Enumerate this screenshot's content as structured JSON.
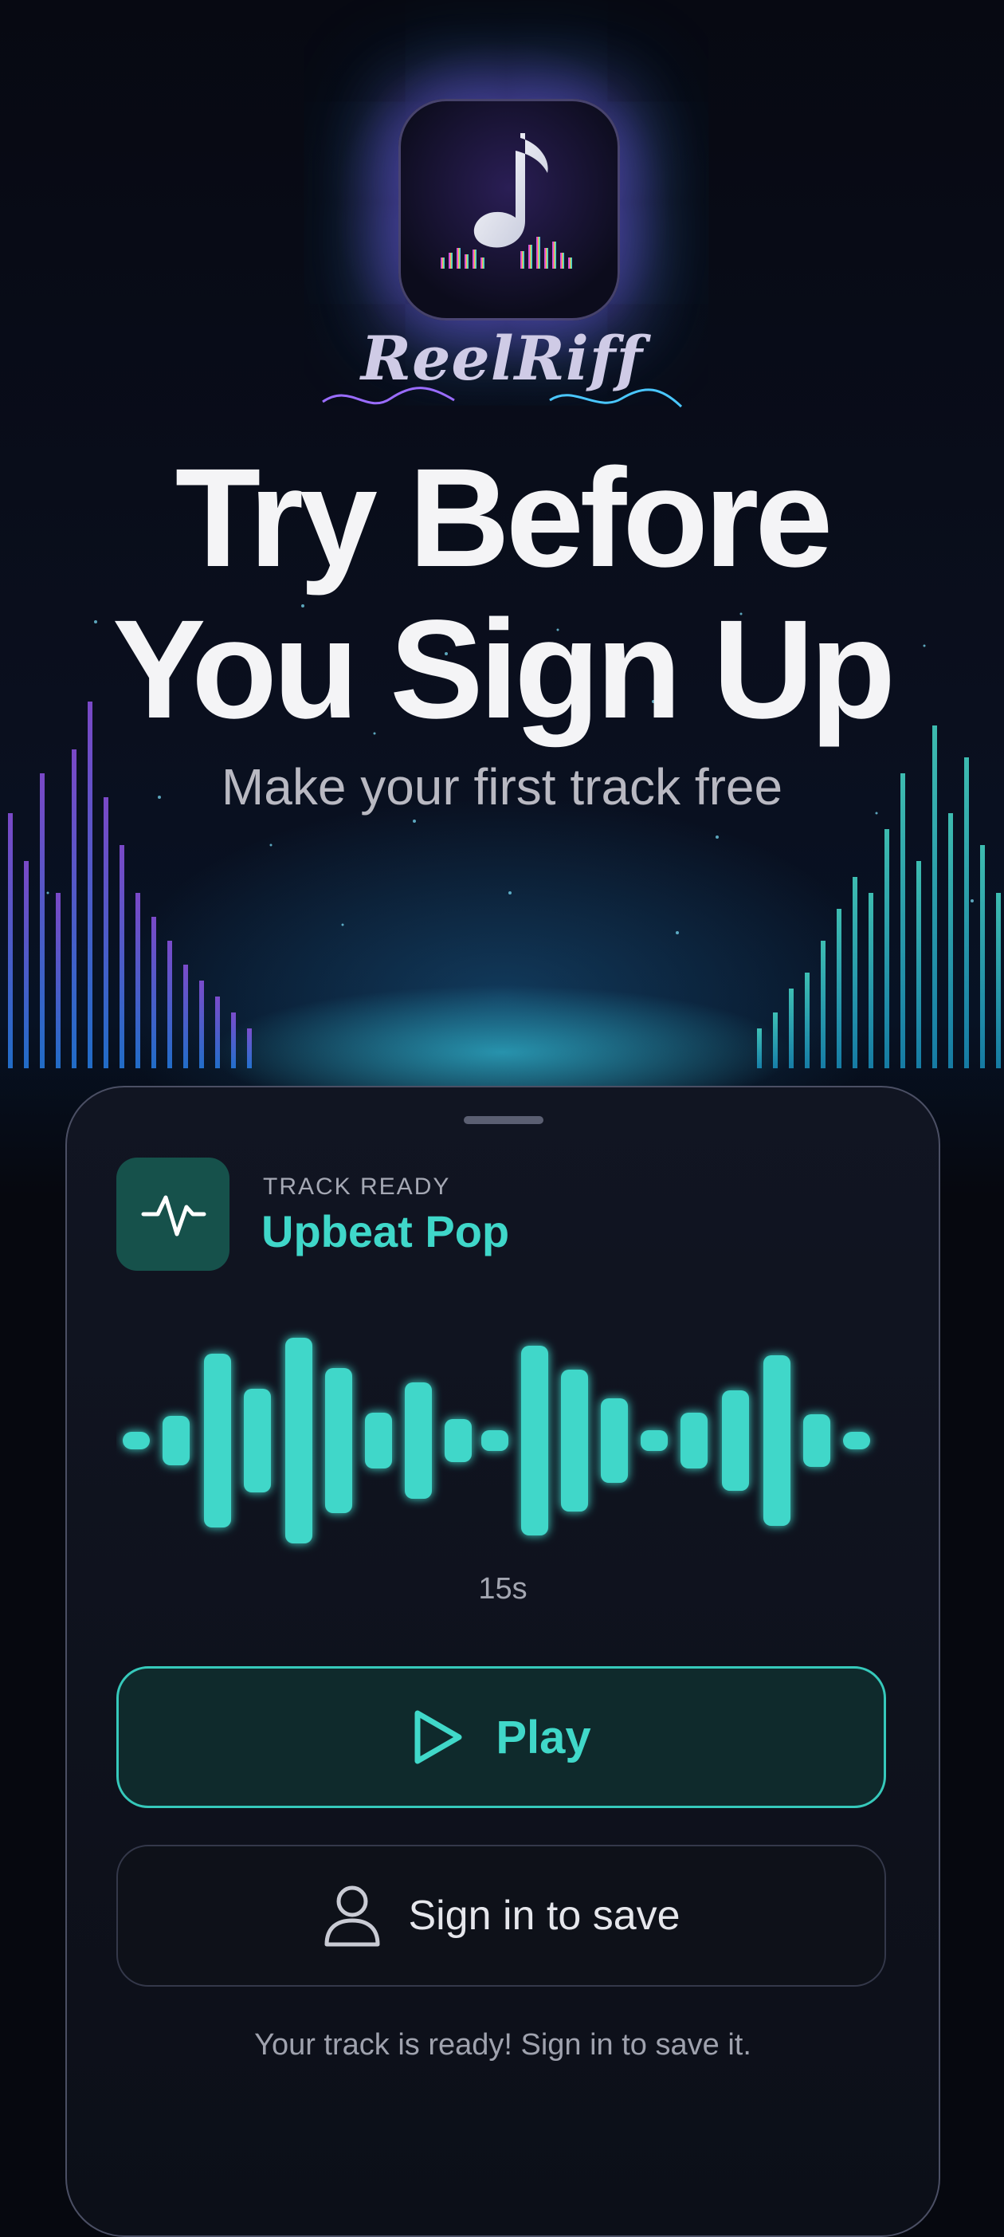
{
  "app": {
    "name": "ReelRiff"
  },
  "hero": {
    "headline_line1": "Try Before",
    "headline_line2": "You Sign Up",
    "subtitle": "Make your first track free"
  },
  "track": {
    "status_label": "TRACK READY",
    "title": "Upbeat Pop",
    "duration": "15s",
    "icon": "waveform-pulse-icon"
  },
  "actions": {
    "play_label": "Play",
    "play_icon": "play-icon",
    "signin_label": "Sign in to save",
    "signin_icon": "user-icon"
  },
  "footer": {
    "hint": "Your track is ready! Sign in to save it."
  },
  "colors": {
    "accent": "#40d8c9",
    "background": "#06080f",
    "card": "#111522",
    "icon_tile": "#16514b"
  }
}
